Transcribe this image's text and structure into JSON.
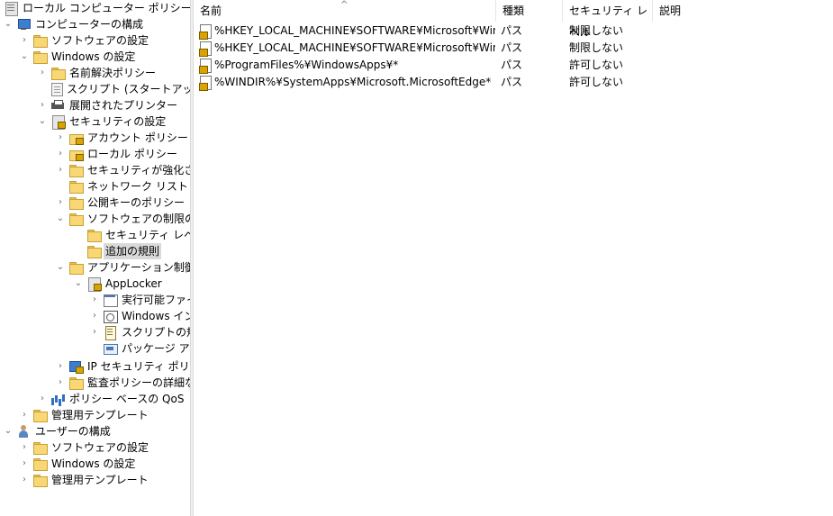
{
  "tree": {
    "root_label": "ローカル コンピューター ポリシー",
    "computer_config": "コンピューターの構成",
    "software_settings": "ソフトウェアの設定",
    "windows_settings": "Windows の設定",
    "name_resolution": "名前解決ポリシー",
    "scripts": "スクリプト (スタートアップ/シャ",
    "deployed_printers": "展開されたプリンター",
    "security_settings": "セキュリティの設定",
    "account_policy": "アカウント ポリシー",
    "local_policy": "ローカル ポリシー",
    "advanced_firewall": "セキュリティが強化された",
    "network_list": "ネットワーク リスト マネー",
    "public_key": "公開キーのポリシー",
    "software_restriction": "ソフトウェアの制限のポリ",
    "security_levels": "セキュリティ レベル",
    "additional_rules": "追加の規則",
    "app_control": "アプリケーション制御ポリ",
    "applocker": "AppLocker",
    "executable_rules": "実行可能ファイ",
    "windows_installer": "Windows イン",
    "script_rules": "スクリプトの規則",
    "packaged_apps": "パッケージ アプリ",
    "ip_security": "IP セキュリティ ポリシー (",
    "audit_policy": "監査ポリシーの詳細な構",
    "qos": "ポリシー ベースの QoS",
    "admin_templates": "管理用テンプレート",
    "user_config": "ユーザーの構成",
    "user_software_settings": "ソフトウェアの設定",
    "user_windows_settings": "Windows の設定",
    "user_admin_templates": "管理用テンプレート"
  },
  "list": {
    "columns": {
      "name": "名前",
      "type": "種類",
      "security_level": "セキュリティ レベル",
      "description": "説明"
    },
    "rows": [
      {
        "name": "%HKEY_LOCAL_MACHINE¥SOFTWARE¥Microsoft¥Windo...",
        "type": "パス",
        "level": "制限しない",
        "description": ""
      },
      {
        "name": "%HKEY_LOCAL_MACHINE¥SOFTWARE¥Microsoft¥Windo...",
        "type": "パス",
        "level": "制限しない",
        "description": ""
      },
      {
        "name": "%ProgramFiles%¥WindowsApps¥*",
        "type": "パス",
        "level": "許可しない",
        "description": ""
      },
      {
        "name": "%WINDIR%¥SystemApps¥Microsoft.MicrosoftEdge*",
        "type": "パス",
        "level": "許可しない",
        "description": ""
      }
    ]
  }
}
